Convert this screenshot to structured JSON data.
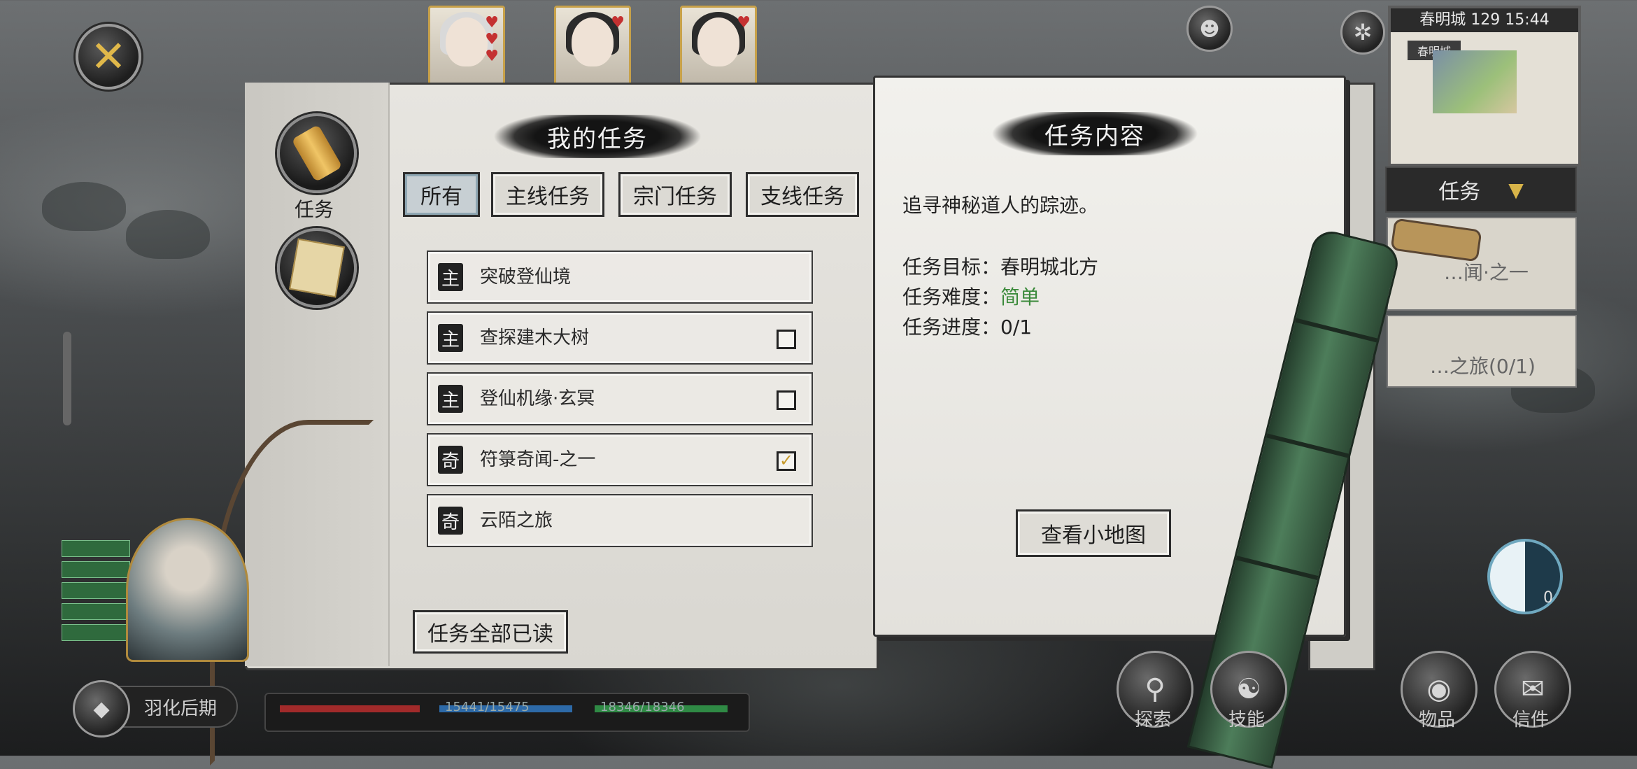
{
  "top_cards": [
    {
      "hearts": "♥\n♥\n♥"
    },
    {
      "hearts": "♥"
    },
    {
      "hearts": "♥"
    }
  ],
  "minimap": {
    "location": "春明城",
    "time": "129 15:44",
    "tag": "春明城"
  },
  "side_panel": {
    "dropdown_label": "任务",
    "task_snippet_1": "…闻·之一",
    "task_snippet_2": "…之旅(0/1)"
  },
  "left_nav": {
    "tasks_label": "任务"
  },
  "task_list": {
    "title": "我的任务",
    "tabs": [
      "所有",
      "主线任务",
      "宗门任务",
      "支线任务"
    ],
    "quests": [
      {
        "badge": "主",
        "title": "突破登仙境",
        "checkbox": "none"
      },
      {
        "badge": "主",
        "title": "查探建木大树",
        "checkbox": "empty"
      },
      {
        "badge": "主",
        "title": "登仙机缘·玄冥",
        "checkbox": "empty"
      },
      {
        "badge": "奇",
        "title": "符箓奇闻-之一",
        "checkbox": "checked"
      },
      {
        "badge": "奇",
        "title": "云陌之旅",
        "checkbox": "none"
      }
    ],
    "read_all_button": "任务全部已读"
  },
  "task_detail": {
    "title": "任务内容",
    "description": "追寻神秘道人的踪迹。",
    "target_label": "任务目标：",
    "target_value": "春明城北方",
    "difficulty_label": "任务难度：",
    "difficulty_value": "简单",
    "progress_label": "任务进度：",
    "progress_value": "0/1",
    "map_button": "查看小地图"
  },
  "hud": {
    "realm": "羽化后期",
    "hp_text": "15441/15475",
    "mp_text": "18346/18346",
    "buttons": [
      "探索",
      "技能",
      "物品",
      "信件"
    ],
    "taiji_count": "0"
  },
  "colors": {
    "easy": "#3b8a3b",
    "ink": "#141414",
    "gold": "#c7a14a"
  }
}
